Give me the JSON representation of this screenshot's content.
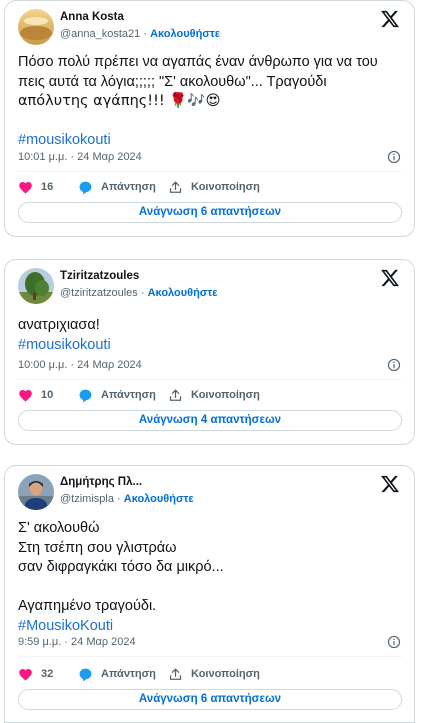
{
  "tweets": [
    {
      "name": "Anna Kosta",
      "handle": "@anna_kosta21",
      "separator": "·",
      "follow_label": "Ακολουθήστε",
      "lines": [
        "Πόσο πολύ πρέπει να αγαπάς έναν άνθρωπο για να του",
        "πεις αυτά τα λόγια;;;;; \"Σ' ακολουθω\"... Τραγούδι",
        "απόλυτης αγάπης!!! 🌹🎶😍",
        "",
        "#mousikokouti"
      ],
      "timestamp": "10:01 μ.μ. · 24 Μαρ 2024",
      "likes": "16",
      "reply_label": "Απάντηση",
      "share_label": "Κοινοποίηση",
      "replies_button": "Ανάγνωση 6 απαντήσεων"
    },
    {
      "name": "Tziritzatzoules",
      "handle": "@tziritzatzoules",
      "separator": "·",
      "follow_label": "Ακολουθήστε",
      "lines": [
        "ανατριχιασα!",
        "#mousikokouti"
      ],
      "timestamp": "10:00 μ.μ. · 24 Μαρ 2024",
      "likes": "10",
      "reply_label": "Απάντηση",
      "share_label": "Κοινοποίηση",
      "replies_button": "Ανάγνωση 4 απαντήσεων"
    },
    {
      "name": "Δημήτρης Πλ...",
      "handle": "@tzimispla",
      "separator": "·",
      "follow_label": "Ακολουθήστε",
      "lines": [
        "Σ' ακολουθώ",
        "Στη τσέπη σου γλιστράω",
        "σαν διφραγκάκι τόσο δα μικρό...",
        "",
        "Αγαπημένο τραγούδι.",
        "#MousikoKouti"
      ],
      "timestamp": "9:59 μ.μ. · 24 Μαρ 2024",
      "likes": "32",
      "reply_label": "Απάντηση",
      "share_label": "Κοινοποίηση",
      "replies_button": "Ανάγνωση 6 απαντήσεων"
    }
  ],
  "colors": {
    "accent": "#006fd6",
    "like": "#f91880",
    "reply": "#1d9bf0",
    "muted": "#536471",
    "border": "#cfd9de"
  },
  "icons": [
    "x-logo-icon",
    "info-icon",
    "heart-icon",
    "reply-bubble-icon",
    "share-icon"
  ]
}
